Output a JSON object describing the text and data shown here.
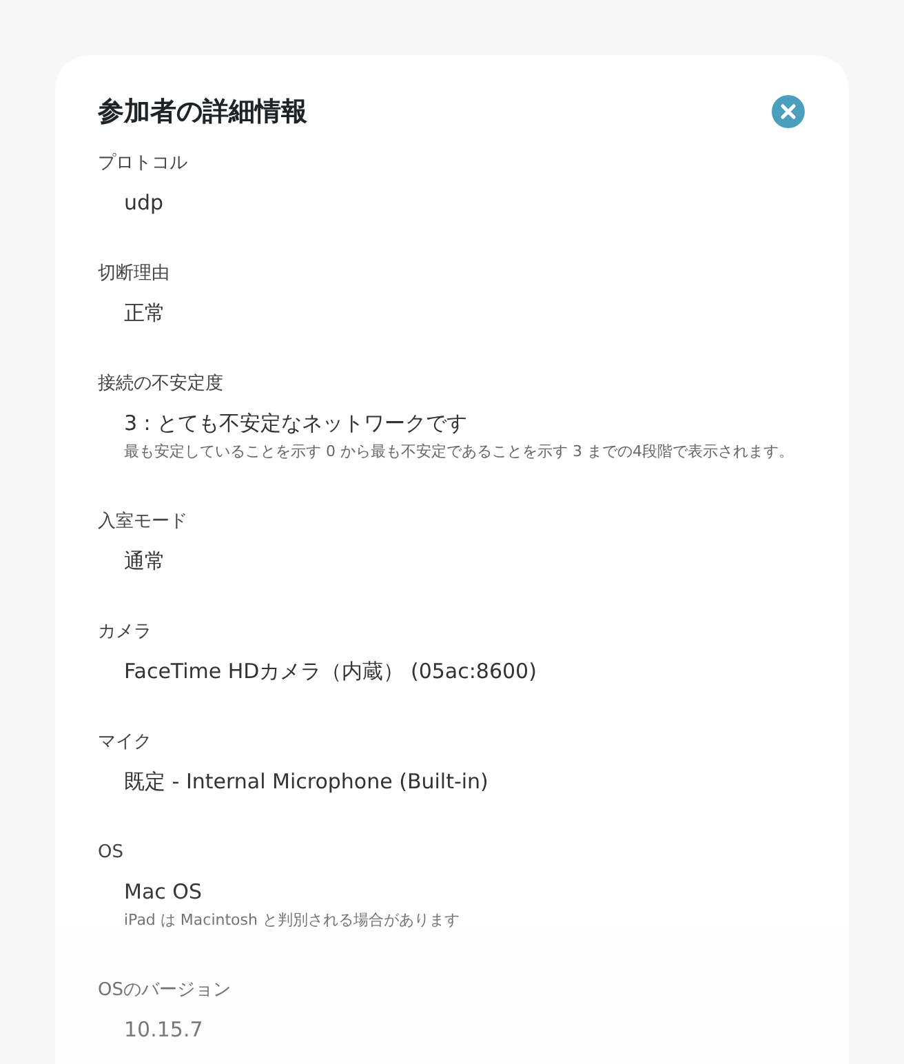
{
  "dialog": {
    "title": "参加者の詳細情報",
    "fields": [
      {
        "label": "プロトコル",
        "value": "udp"
      },
      {
        "label": "切断理由",
        "value": "正常"
      },
      {
        "label": "接続の不安定度",
        "value": "3 : とても不安定なネットワークです",
        "note": "最も安定していることを示す 0 から最も不安定であることを示す 3 までの4段階で表示されます。"
      },
      {
        "label": "入室モード",
        "value": "通常"
      },
      {
        "label": "カメラ",
        "value": "FaceTime HDカメラ（内蔵） (05ac:8600)"
      },
      {
        "label": "マイク",
        "value": "既定 - Internal Microphone (Built-in)"
      },
      {
        "label": "OS",
        "value": "Mac OS",
        "note": "iPad は Macintosh と判別される場合があります"
      },
      {
        "label": "OSのバージョン",
        "value": "10.15.7"
      }
    ]
  }
}
